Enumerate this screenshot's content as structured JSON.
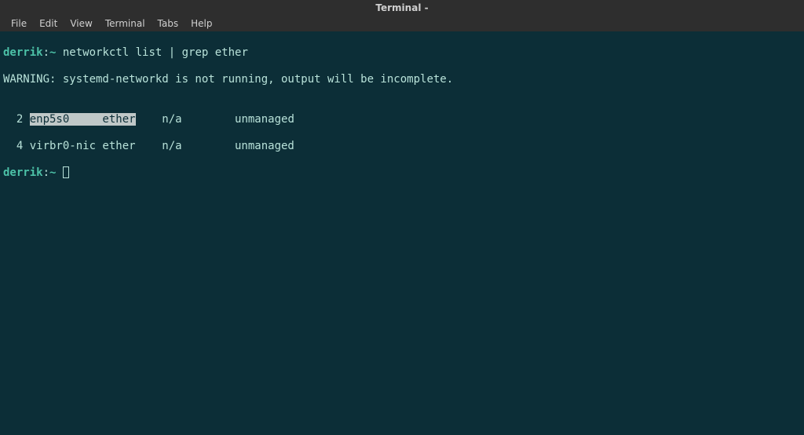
{
  "window": {
    "title": "Terminal -"
  },
  "menu": {
    "file": "File",
    "edit": "Edit",
    "view": "View",
    "terminal": "Terminal",
    "tabs": "Tabs",
    "help": "Help"
  },
  "terminal": {
    "prompt_user": "derrik",
    "prompt_sep": ":",
    "prompt_path": "~",
    "command": " networkctl list | grep ether",
    "warning": "WARNING: systemd-networkd is not running, output will be incomplete.",
    "blank": "",
    "row1_prefix": "  2 ",
    "row1_highlight": "enp5s0     ether",
    "row1_rest": "    n/a        unmanaged",
    "row2": "  4 virbr0-nic ether    n/a        unmanaged"
  }
}
